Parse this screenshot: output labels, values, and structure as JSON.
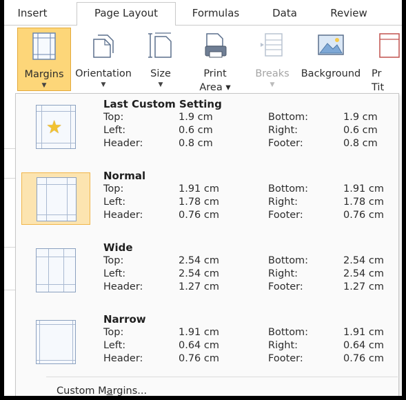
{
  "tabs": [
    "Insert",
    "Page Layout",
    "Formulas",
    "Data",
    "Review"
  ],
  "active_tab": "Page Layout",
  "ribbon": {
    "margins": {
      "label": "Margins"
    },
    "orientation": {
      "label": "Orientation"
    },
    "size": {
      "label": "Size"
    },
    "print_area": {
      "label1": "Print",
      "label2": "Area"
    },
    "breaks": {
      "label": "Breaks"
    },
    "background": {
      "label": "Background"
    },
    "print_titles": {
      "label1": "Pr",
      "label2": "Tit"
    }
  },
  "margin_options": [
    {
      "title": "Last Custom Setting",
      "top": "1.9 cm",
      "bottom": "1.9 cm",
      "left": "0.6 cm",
      "right": "0.6 cm",
      "header": "0.8 cm",
      "footer": "0.8 cm",
      "icon": "star-icon"
    },
    {
      "title": "Normal",
      "top": "1.91 cm",
      "bottom": "1.91 cm",
      "left": "1.78 cm",
      "right": "1.78 cm",
      "header": "0.76 cm",
      "footer": "0.76 cm",
      "highlighted": true
    },
    {
      "title": "Wide",
      "top": "2.54 cm",
      "bottom": "2.54 cm",
      "left": "2.54 cm",
      "right": "2.54 cm",
      "header": "1.27 cm",
      "footer": "1.27 cm"
    },
    {
      "title": "Narrow",
      "top": "1.91 cm",
      "bottom": "1.91 cm",
      "left": "0.64 cm",
      "right": "0.64 cm",
      "header": "0.76 cm",
      "footer": "0.76 cm"
    }
  ],
  "field_labels": {
    "top": "Top:",
    "bottom": "Bottom:",
    "left": "Left:",
    "right": "Right:",
    "header": "Header:",
    "footer": "Footer:"
  },
  "custom_margins": {
    "prefix": "Custom M",
    "underlined": "a",
    "suffix": "rgins..."
  },
  "colors": {
    "selected_fill": "#fdd679",
    "selected_border": "#e3a93a",
    "highlight_fill": "#fce4b0",
    "panel_bg": "#fafafa"
  }
}
